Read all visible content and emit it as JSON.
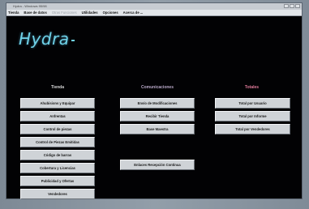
{
  "window": {
    "title": "Hydra - Windows 95/98",
    "menu": [
      {
        "label": "Tienda",
        "enabled": true
      },
      {
        "label": "Base de datos",
        "enabled": true
      },
      {
        "label": "Otras Funciones",
        "enabled": false
      },
      {
        "label": "Utilidades",
        "enabled": true
      },
      {
        "label": "Opciones",
        "enabled": true
      },
      {
        "label": "Acerca de ...",
        "enabled": true
      }
    ]
  },
  "brand": {
    "logo_text": "Hydra",
    "logo_color": "#6fd2e8"
  },
  "columns": {
    "tienda": {
      "heading": "Tienda",
      "heading_color": "#d8d8d8",
      "buttons": [
        "Ahubisions y Equipar",
        "Anfrentas",
        "Control de piezas",
        "Control de Piezas Emitidas",
        "Código de barras",
        "Cobertura y Licencias",
        "Publicidad y Ofertas",
        "Vendedores"
      ]
    },
    "comunicaciones": {
      "heading": "Comunicaciones",
      "heading_color": "#b8a8c8",
      "buttons": [
        "Envío de Modificaciones",
        "Recibir Tienda",
        "Base Maestra"
      ],
      "extra_button": "Enlaces Recepción Continua"
    },
    "totales": {
      "heading": "Totales",
      "heading_color": "#e07a9a",
      "buttons": [
        "Total por Usuario",
        "Total por Informe",
        "Total por Vendedores"
      ]
    }
  }
}
